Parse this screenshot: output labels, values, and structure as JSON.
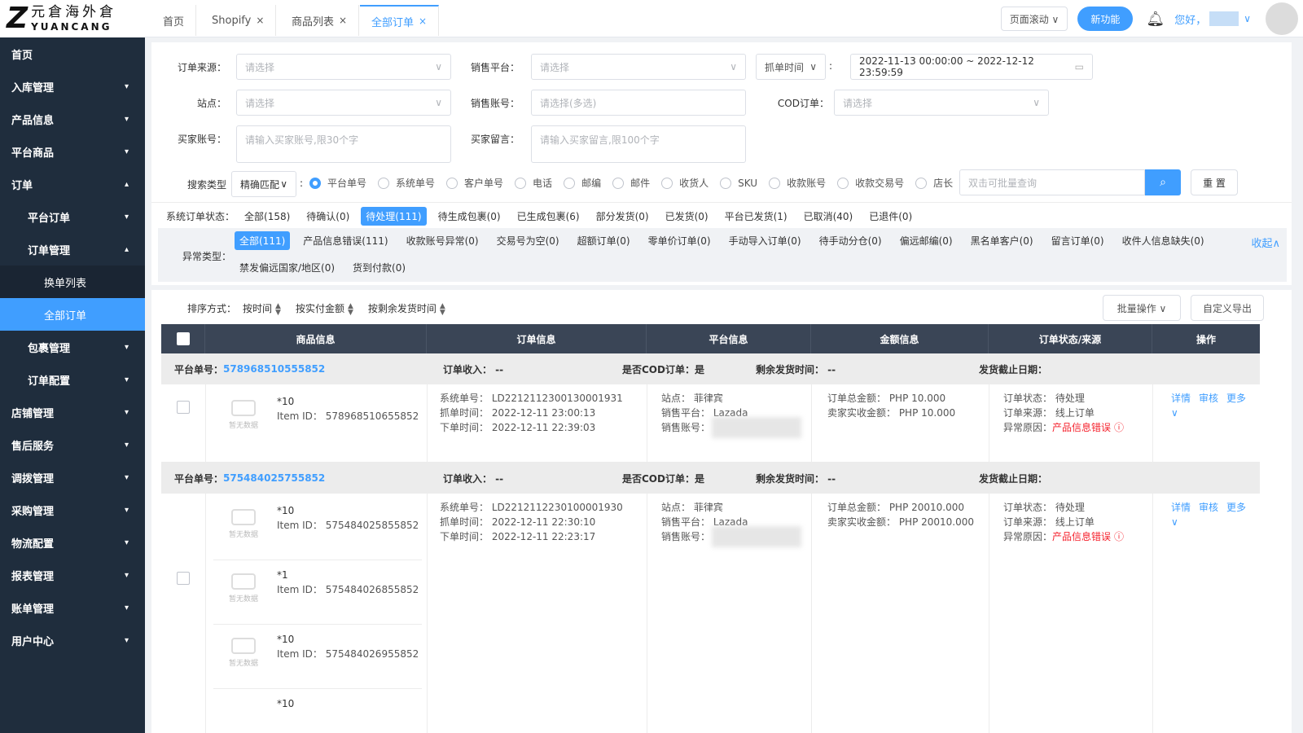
{
  "logo": {
    "cn": "元倉海外倉",
    "en": "YUANCANG",
    "mark": "Z"
  },
  "sidebar": {
    "items": [
      {
        "label": "首页",
        "level": 1,
        "chev": ""
      },
      {
        "label": "入库管理",
        "level": 1,
        "chev": "▾"
      },
      {
        "label": "产品信息",
        "level": 1,
        "chev": "▾"
      },
      {
        "label": "平台商品",
        "level": 1,
        "chev": "▾"
      },
      {
        "label": "订单",
        "level": 1,
        "chev": "▴"
      },
      {
        "label": "平台订单",
        "level": 2,
        "chev": "▾"
      },
      {
        "label": "订单管理",
        "level": 2,
        "chev": "▴"
      },
      {
        "label": "换单列表",
        "level": 3,
        "chev": ""
      },
      {
        "label": "全部订单",
        "level": 3,
        "chev": "",
        "active": true
      },
      {
        "label": "包裹管理",
        "level": 2,
        "chev": "▾"
      },
      {
        "label": "订单配置",
        "level": 2,
        "chev": "▾"
      },
      {
        "label": "店铺管理",
        "level": 1,
        "chev": "▾"
      },
      {
        "label": "售后服务",
        "level": 1,
        "chev": "▾"
      },
      {
        "label": "调拨管理",
        "level": 1,
        "chev": "▾"
      },
      {
        "label": "采购管理",
        "level": 1,
        "chev": "▾"
      },
      {
        "label": "物流配置",
        "level": 1,
        "chev": "▾"
      },
      {
        "label": "报表管理",
        "level": 1,
        "chev": "▾"
      },
      {
        "label": "账单管理",
        "level": 1,
        "chev": "▾"
      },
      {
        "label": "用户中心",
        "level": 1,
        "chev": "▾"
      }
    ]
  },
  "tabs": [
    {
      "label": "首页",
      "close": ""
    },
    {
      "label": "Shopify",
      "close": "×"
    },
    {
      "label": "商品列表",
      "close": "×"
    },
    {
      "label": "全部订单",
      "close": "×"
    }
  ],
  "topbar": {
    "scroll_label": "页面滚动 ∨",
    "new_feature": "新功能",
    "greeting": "您好，"
  },
  "filters": {
    "order_source": {
      "label": "订单来源：",
      "placeholder": "请选择"
    },
    "sales_platform": {
      "label": "销售平台：",
      "placeholder": "请选择"
    },
    "grab_time": {
      "label": "抓单时间",
      "value": "2022-11-13 00:00:00 ~ 2022-12-12 23:59:59"
    },
    "site": {
      "label": "站点：",
      "placeholder": "请选择"
    },
    "sales_account": {
      "label": "销售账号：",
      "placeholder": "请选择(多选)"
    },
    "cod": {
      "label": "COD订单：",
      "placeholder": "请选择"
    },
    "buyer_account": {
      "label": "买家账号：",
      "placeholder": "请输入买家账号,限30个字"
    },
    "buyer_message": {
      "label": "买家留言：",
      "placeholder": "请输入买家留言,限100个字"
    },
    "search_type": {
      "label": "搜索类型",
      "match": "精确匹配"
    },
    "search_options": [
      "平台单号",
      "系统单号",
      "客户单号",
      "电话",
      "邮编",
      "邮件",
      "收货人",
      "SKU",
      "收款账号",
      "收款交易号",
      "店长"
    ],
    "batch_query_placeholder": "双击可批量查询",
    "reset": "重 置"
  },
  "status": {
    "label": "系统订单状态：",
    "items": [
      "全部(158)",
      "待确认(0)",
      "待处理(111)",
      "待生成包裹(0)",
      "已生成包裹(6)",
      "部分发货(0)",
      "已发货(0)",
      "平台已发货(1)",
      "已取消(40)",
      "已退件(0)"
    ],
    "active": 2
  },
  "exceptions": {
    "label": "异常类型：",
    "row1": [
      "全部(111)",
      "产品信息错误(111)",
      "收款账号异常(0)",
      "交易号为空(0)",
      "超额订单(0)",
      "零单价订单(0)",
      "手动导入订单(0)",
      "待手动分仓(0)",
      "偏远邮编(0)",
      "黑名单客户(0)",
      "留言订单(0)",
      "收件人信息缺失(0)"
    ],
    "row2": [
      "禁发偏远国家/地区(0)",
      "货到付款(0)"
    ],
    "collapse": "收起∧"
  },
  "sort": {
    "label": "排序方式：",
    "options": [
      "按时间",
      "按实付金额",
      "按剩余发货时间"
    ],
    "batch": "批量操作 ∨",
    "export": "自定义导出"
  },
  "table": {
    "headers": [
      "商品信息",
      "订单信息",
      "平台信息",
      "金额信息",
      "订单状态/来源",
      "操作"
    ]
  },
  "orders": [
    {
      "platform_no_label": "平台单号：",
      "platform_no": "578968510555852",
      "income": "订单收入：  --",
      "cod": "是否COD订单：是",
      "remaining": "剩余发货时间：  --",
      "deadline": "发货截止日期：",
      "products": [
        {
          "qty": "*10",
          "item": "Item ID： 578968510655852",
          "nodata": "暂无数据"
        }
      ],
      "sys_no": "系统单号： LD2212112300130001931",
      "grab": "抓单时间： 2022-12-11 23:00:13",
      "placed": "下单时间： 2022-12-11 22:39:03",
      "site": "站点： 菲律宾",
      "platform": "销售平台： Lazada",
      "account": "销售账号：",
      "total": "订单总金额： PHP 10.000",
      "received": "卖家实收金额： PHP 10.000",
      "state": "订单状态： 待处理",
      "source": "订单来源： 线上订单",
      "abn_label": "异常原因：",
      "abn": "产品信息错误",
      "ops": [
        "详情",
        "审核",
        "更多∨"
      ]
    },
    {
      "platform_no_label": "平台单号：",
      "platform_no": "575484025755852",
      "income": "订单收入：  --",
      "cod": "是否COD订单：是",
      "remaining": "剩余发货时间：  --",
      "deadline": "发货截止日期：",
      "products": [
        {
          "qty": "*10",
          "item": "Item ID： 575484025855852",
          "nodata": "暂无数据"
        },
        {
          "qty": "*1",
          "item": "Item ID： 575484026855852",
          "nodata": "暂无数据"
        },
        {
          "qty": "*10",
          "item": "Item ID： 575484026955852",
          "nodata": "暂无数据"
        },
        {
          "qty": "*10",
          "item": "",
          "nodata": ""
        }
      ],
      "sys_no": "系统单号： LD2212112230100001930",
      "grab": "抓单时间： 2022-12-11 22:30:10",
      "placed": "下单时间： 2022-12-11 22:23:17",
      "site": "站点： 菲律宾",
      "platform": "销售平台： Lazada",
      "account": "销售账号：",
      "total": "订单总金额： PHP 20010.000",
      "received": "卖家实收金额： PHP 20010.000",
      "state": "订单状态： 待处理",
      "source": "订单来源： 线上订单",
      "abn_label": "异常原因：",
      "abn": "产品信息错误",
      "ops": [
        "详情",
        "审核",
        "更多∨"
      ]
    }
  ],
  "colors": {
    "sidebar": "#1f2d3d",
    "accent": "#409eff",
    "header": "#3a4556",
    "error": "#f5222d"
  }
}
